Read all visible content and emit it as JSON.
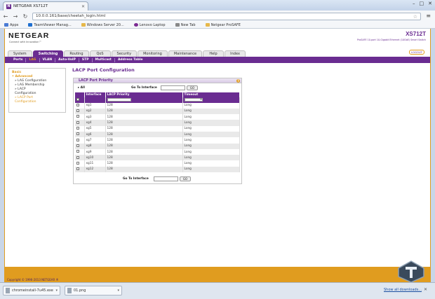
{
  "browser": {
    "tab_title": "NETGEAR XS712T",
    "url": "10.0.0.161/base/cheetah_login.html",
    "bookmarks": [
      {
        "label": "Apps",
        "icon": "apps-icon"
      },
      {
        "label": "TeamViewer Manag...",
        "icon": "teamviewer-icon"
      },
      {
        "label": "Windows Server 20...",
        "icon": "folder-icon"
      },
      {
        "label": "Lenovo Laptop",
        "icon": "lenovo-icon"
      },
      {
        "label": "New Tab",
        "icon": "page-icon"
      },
      {
        "label": "Netgear ProSAFE",
        "icon": "folder-icon"
      }
    ]
  },
  "header": {
    "logo": "NETGEAR",
    "tagline": "Connect with Innovation™",
    "model": "XS712T",
    "model_sub": "ProSAFE 10-port 10-Gigabit Ethernet (10GbE) Smart Switch",
    "logout": "LOGOUT"
  },
  "main_nav": [
    "System",
    "Switching",
    "Routing",
    "QoS",
    "Security",
    "Monitoring",
    "Maintenance",
    "Help",
    "Index"
  ],
  "main_nav_active": 1,
  "sub_nav": [
    "Ports",
    "LAG",
    "VLAN",
    "Auto-VoIP",
    "STP",
    "Multicast",
    "Address Table"
  ],
  "sub_nav_active": 1,
  "sidebar": {
    "items": [
      {
        "label": "Basic",
        "type": "heading"
      },
      {
        "label": "• Advanced",
        "type": "heading"
      },
      {
        "label": "» LAG Configuration",
        "type": "item"
      },
      {
        "label": "» LAG Membership",
        "type": "item"
      },
      {
        "label": "» LACP",
        "type": "item"
      },
      {
        "label": "Configuration",
        "type": "item"
      },
      {
        "label": "» LACP Port",
        "type": "active"
      },
      {
        "label": "Configuration",
        "type": "active"
      }
    ]
  },
  "content": {
    "page_title": "LACP Port Configuration",
    "panel_title": "LACP Port Priority",
    "help": "?",
    "all_label": "All",
    "goto_label": "Go To Interface",
    "go_button": "GO",
    "columns": [
      "Interface",
      "LACP Priority",
      "Timeout"
    ],
    "rows": [
      {
        "iface": "xg1",
        "priority": "128",
        "timeout": "Long"
      },
      {
        "iface": "xg2",
        "priority": "128",
        "timeout": "Long"
      },
      {
        "iface": "xg3",
        "priority": "128",
        "timeout": "Long"
      },
      {
        "iface": "xg4",
        "priority": "128",
        "timeout": "Long"
      },
      {
        "iface": "xg5",
        "priority": "128",
        "timeout": "Long"
      },
      {
        "iface": "xg6",
        "priority": "128",
        "timeout": "Long"
      },
      {
        "iface": "xg7",
        "priority": "128",
        "timeout": "Long"
      },
      {
        "iface": "xg8",
        "priority": "128",
        "timeout": "Long"
      },
      {
        "iface": "xg9",
        "priority": "128",
        "timeout": "Long"
      },
      {
        "iface": "xg10",
        "priority": "128",
        "timeout": "Long"
      },
      {
        "iface": "xg11",
        "priority": "128",
        "timeout": "Long"
      },
      {
        "iface": "xg12",
        "priority": "128",
        "timeout": "Long"
      }
    ]
  },
  "footer": {
    "copyright": "Copyright © 1996-2013 NETGEAR ®"
  },
  "downloads": {
    "items": [
      {
        "name": "chromeinstall-7u45.exe"
      },
      {
        "name": "01.png"
      }
    ],
    "show_all": "Show all downloads..."
  },
  "colors": {
    "purple": "#6a2c91",
    "orange": "#e09c1f"
  }
}
